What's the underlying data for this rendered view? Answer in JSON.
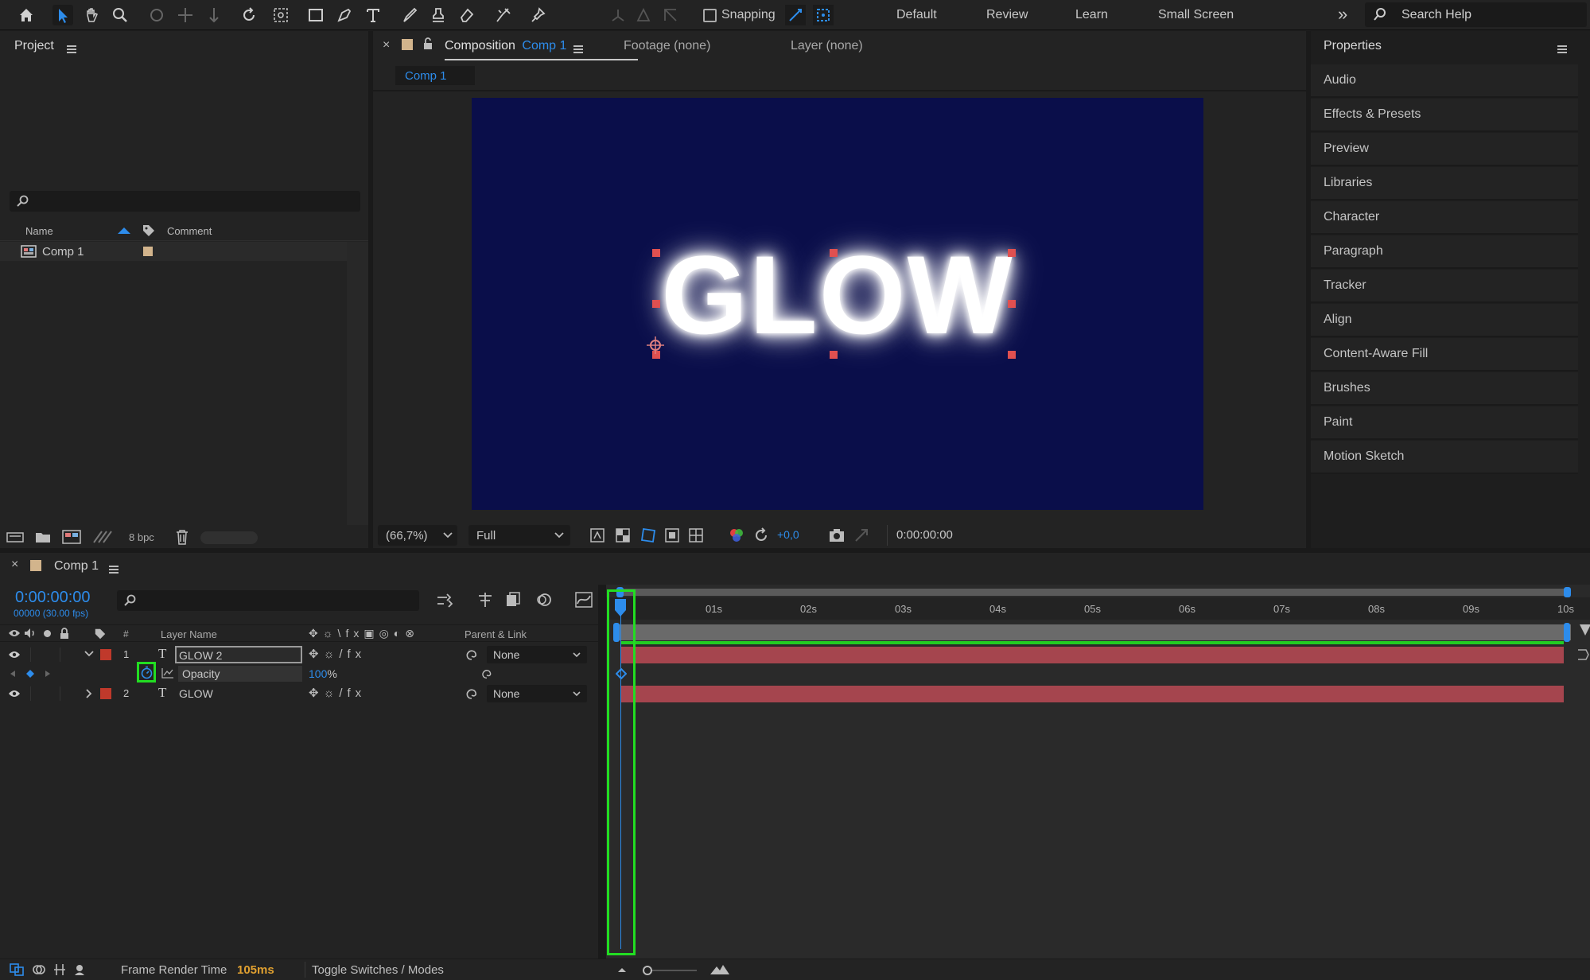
{
  "toolbar": {
    "snapping_label": "Snapping",
    "workspaces": [
      "Default",
      "Review",
      "Learn",
      "Small Screen"
    ],
    "search_placeholder": "Search Help"
  },
  "project": {
    "title": "Project",
    "columns": {
      "name": "Name",
      "comment": "Comment"
    },
    "items": [
      {
        "name": "Comp 1"
      }
    ],
    "bpc": "8 bpc"
  },
  "composition": {
    "tab_prefix": "Composition",
    "tab_name": "Comp 1",
    "footage_tab": "Footage (none)",
    "layer_tab": "Layer (none)",
    "breadcrumb": "Comp 1",
    "canvas_text": "GLOW",
    "canvas_bg": "#0a0e4a",
    "zoom": "(66,7%)",
    "resolution": "Full",
    "exposure": "+0,0",
    "timecode": "0:00:00:00"
  },
  "properties": {
    "title": "Properties",
    "items": [
      "Audio",
      "Effects & Presets",
      "Preview",
      "Libraries",
      "Character",
      "Paragraph",
      "Tracker",
      "Align",
      "Content-Aware Fill",
      "Brushes",
      "Paint",
      "Motion Sketch"
    ]
  },
  "timeline": {
    "tab": "Comp 1",
    "current_time": "0:00:00:00",
    "frame_info": "00000 (30.00 fps)",
    "columns": {
      "num": "#",
      "layer_name": "Layer Name",
      "parent": "Parent & Link"
    },
    "ruler": [
      "01s",
      "02s",
      "03s",
      "04s",
      "05s",
      "06s",
      "07s",
      "08s",
      "09s",
      "10s"
    ],
    "layers": [
      {
        "num": "1",
        "name": "GLOW 2",
        "parent": "None",
        "color": "#c0392b"
      },
      {
        "num": "2",
        "name": "GLOW",
        "parent": "None",
        "color": "#c0392b"
      }
    ],
    "property": {
      "name": "Opacity",
      "value": "100",
      "unit": "%"
    }
  },
  "status": {
    "frame_render_label": "Frame Render Time",
    "frame_render_value": "105ms",
    "toggle_label": "Toggle Switches / Modes"
  }
}
